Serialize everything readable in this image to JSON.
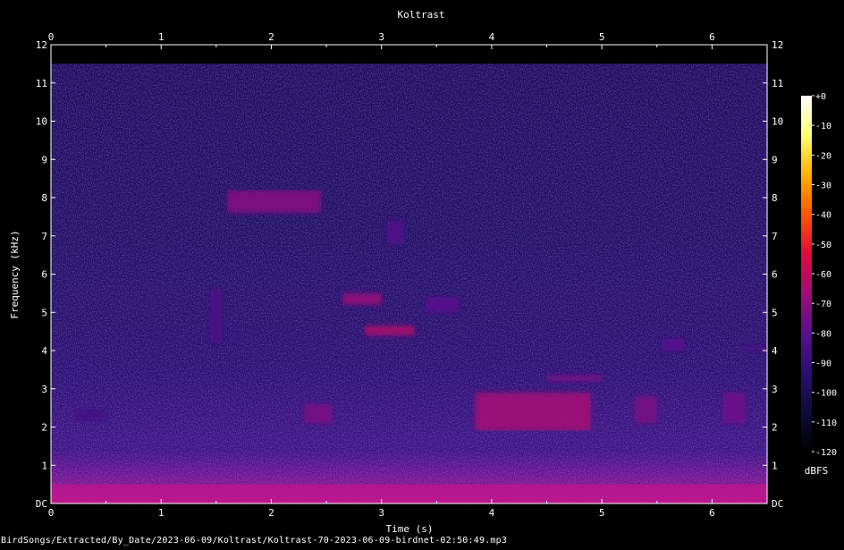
{
  "chart_data": {
    "type": "heatmap",
    "title": "Koltrast",
    "xlabel": "Time (s)",
    "ylabel": "Frequency (kHz)",
    "xlim": [
      0,
      6.5
    ],
    "ylim": [
      0,
      12
    ],
    "x_ticks": [
      "0",
      "1",
      "2",
      "3",
      "4",
      "5",
      "6"
    ],
    "y_ticks": [
      "DC",
      "1",
      "2",
      "3",
      "4",
      "5",
      "6",
      "7",
      "8",
      "9",
      "10",
      "11",
      "12"
    ],
    "colorbar": {
      "label": "dBFS",
      "range": [
        -120,
        0
      ],
      "ticks": [
        "+0",
        "-10",
        "-20",
        "-30",
        "-40",
        "-50",
        "-60",
        "-70",
        "-80",
        "-90",
        "-100",
        "-110",
        "-120"
      ],
      "colormap": [
        "#000000",
        "#0c0c3a",
        "#2a0f72",
        "#5a0f8e",
        "#a00c7a",
        "#e00a3a",
        "#ff5500",
        "#ffb000",
        "#ffff70",
        "#ffffff"
      ]
    },
    "noise_ceiling_khz": 11.5,
    "events": [
      {
        "t0": 1.6,
        "t1": 2.45,
        "f0": 7.6,
        "f1": 8.2,
        "level": -72
      },
      {
        "t0": 2.65,
        "t1": 3.0,
        "f0": 5.2,
        "f1": 5.5,
        "level": -68
      },
      {
        "t0": 2.85,
        "t1": 3.3,
        "f0": 4.4,
        "f1": 4.65,
        "level": -64
      },
      {
        "t0": 3.4,
        "t1": 3.7,
        "f0": 5.0,
        "f1": 5.4,
        "level": -80
      },
      {
        "t0": 3.05,
        "t1": 3.2,
        "f0": 6.8,
        "f1": 7.4,
        "level": -82
      },
      {
        "t0": 2.3,
        "t1": 2.55,
        "f0": 2.1,
        "f1": 2.6,
        "level": -74
      },
      {
        "t0": 3.85,
        "t1": 4.9,
        "f0": 1.9,
        "f1": 2.9,
        "level": -66
      },
      {
        "t0": 4.5,
        "t1": 5.0,
        "f0": 3.2,
        "f1": 3.35,
        "level": -74
      },
      {
        "t0": 5.3,
        "t1": 5.5,
        "f0": 2.1,
        "f1": 2.8,
        "level": -74
      },
      {
        "t0": 6.1,
        "t1": 6.3,
        "f0": 2.1,
        "f1": 2.9,
        "level": -76
      },
      {
        "t0": 5.55,
        "t1": 5.75,
        "f0": 4.0,
        "f1": 4.3,
        "level": -80
      },
      {
        "t0": 6.3,
        "t1": 6.5,
        "f0": 4.0,
        "f1": 4.1,
        "level": -82
      },
      {
        "t0": 1.45,
        "t1": 1.55,
        "f0": 4.2,
        "f1": 5.6,
        "level": -84
      },
      {
        "t0": 0.2,
        "t1": 0.5,
        "f0": 2.2,
        "f1": 2.4,
        "level": -86
      }
    ]
  },
  "footer_path": "BirdSongs/Extracted/By_Date/2023-06-09/Koltrast/Koltrast-70-2023-06-09-birdnet-02:50:49.mp3"
}
